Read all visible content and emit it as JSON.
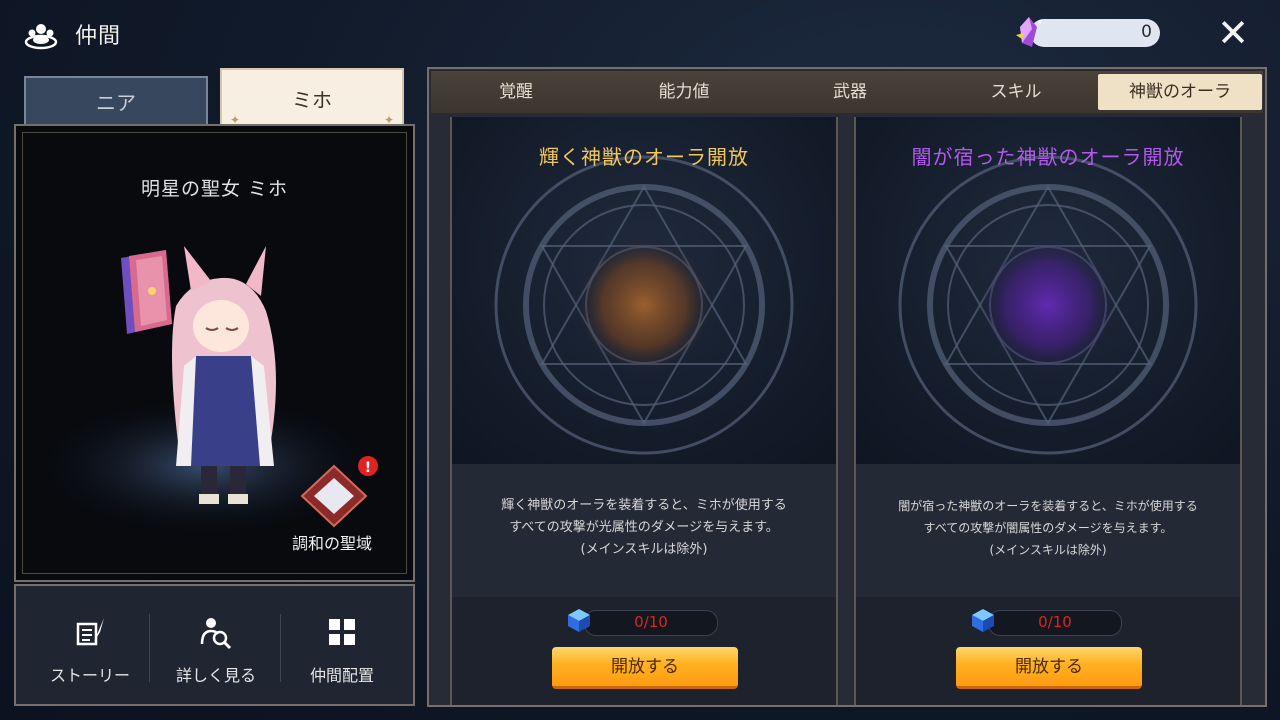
{
  "header": {
    "title": "仲間",
    "currency_value": "0"
  },
  "char_tabs": [
    {
      "label": "ニア"
    },
    {
      "label": "ミホ"
    }
  ],
  "character": {
    "name": "明星の聖女 ミホ",
    "sanctuary_label": "調和の聖域"
  },
  "actions": [
    {
      "label": "ストーリー"
    },
    {
      "label": "詳しく見る"
    },
    {
      "label": "仲間配置"
    }
  ],
  "tabs": [
    {
      "label": "覚醒"
    },
    {
      "label": "能力値"
    },
    {
      "label": "武器"
    },
    {
      "label": "スキル"
    },
    {
      "label": "神獣のオーラ"
    }
  ],
  "selected_tab": "神獣のオーラ",
  "auras": [
    {
      "title": "輝く神獣のオーラ開放",
      "title_color": "#f3c85a",
      "desc_line1": "輝く神獣のオーラを装着すると、ミホが使用する",
      "desc_line2": "すべての攻撃が光属性のダメージを与えます。",
      "desc_line3": "(メインスキルは除外)",
      "progress": "0/10",
      "button": "開放する",
      "orb_color": "#b06a2c"
    },
    {
      "title": "闇が宿った神獣のオーラ開放",
      "title_color": "#b458ee",
      "desc_line1": "闇が宿った神獣のオーラを装着すると、ミホが使用する",
      "desc_line2": "すべての攻撃が闇属性のダメージを与えます。",
      "desc_line3": "(メインスキルは除外)",
      "progress": "0/10",
      "button": "開放する",
      "orb_color": "#6a2ac0"
    }
  ]
}
